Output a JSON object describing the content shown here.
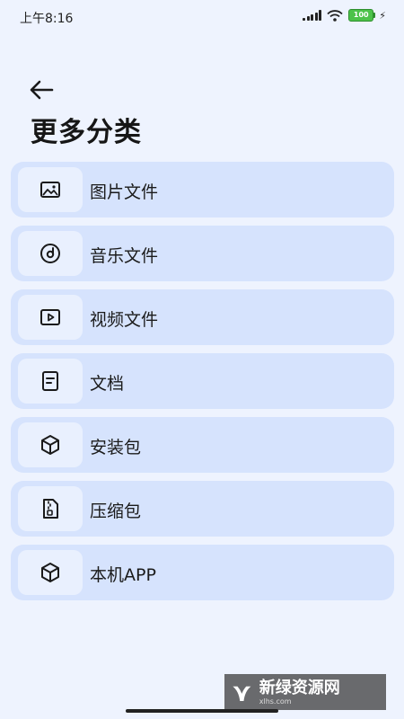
{
  "status_bar": {
    "time": "上午8:16",
    "battery": "100"
  },
  "page": {
    "title": "更多分类"
  },
  "categories": [
    {
      "label": "图片文件",
      "icon": "image-icon"
    },
    {
      "label": "音乐文件",
      "icon": "music-disc-icon"
    },
    {
      "label": "视频文件",
      "icon": "video-icon"
    },
    {
      "label": "文档",
      "icon": "document-icon"
    },
    {
      "label": "安装包",
      "icon": "package-box-icon"
    },
    {
      "label": "压缩包",
      "icon": "zip-archive-icon"
    },
    {
      "label": "本机APP",
      "icon": "app-box-icon"
    }
  ],
  "watermark": {
    "brand": "新绿资源网",
    "domain": "xlhs.com"
  },
  "colors": {
    "background": "#EEF3FE",
    "card": "#D6E3FD",
    "icon_box": "#E9F0FE"
  }
}
